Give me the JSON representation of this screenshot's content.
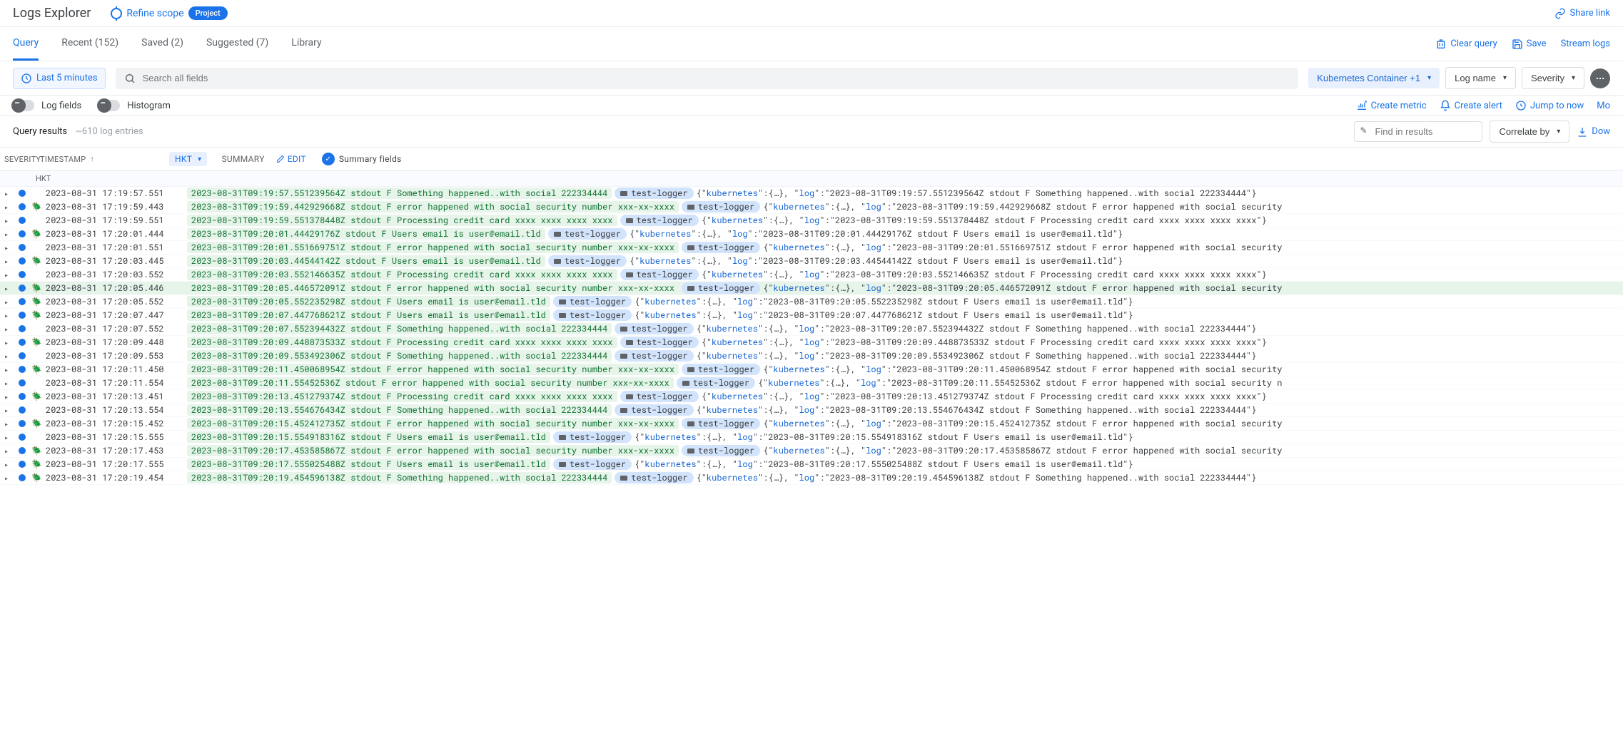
{
  "header": {
    "title": "Logs Explorer",
    "refine": "Refine scope",
    "project_badge": "Project",
    "share": "Share link"
  },
  "tabs": {
    "items": [
      "Query",
      "Recent (152)",
      "Saved (2)",
      "Suggested (7)",
      "Library"
    ],
    "active_index": 0,
    "actions": {
      "clear": "Clear query",
      "save": "Save",
      "stream": "Stream logs"
    }
  },
  "query_bar": {
    "time_range": "Last 5 minutes",
    "search_placeholder": "Search all fields",
    "filters": {
      "resource": "Kubernetes Container +1",
      "log_name": "Log name",
      "severity": "Severity"
    }
  },
  "view_toggles": {
    "log_fields": "Log fields",
    "histogram": "Histogram",
    "actions": {
      "create_metric": "Create metric",
      "create_alert": "Create alert",
      "jump_now": "Jump to now",
      "more": "Mo"
    }
  },
  "results": {
    "label": "Query results",
    "count": "~610 log entries",
    "find_placeholder": "Find in results",
    "correlate": "Correlate by",
    "download": "Dow"
  },
  "columns": {
    "severity": "SEVERITY",
    "timestamp": "TIMESTAMP",
    "tz": "HKT",
    "summary": "SUMMARY",
    "edit": "EDIT",
    "summary_fields": "Summary fields",
    "tz_sub": "HKT"
  },
  "logger_name": "test-logger",
  "logs": [
    {
      "bug": false,
      "ts": "2023-08-31 17:19:57.551",
      "msg": "2023-08-31T09:19:57.551239564Z stdout F Something happened..with social 222334444",
      "tail": "{\"kubernetes\":{…}, \"log\":\"2023-08-31T09:19:57.551239564Z stdout F Something happened..with social 222334444\"}"
    },
    {
      "bug": true,
      "ts": "2023-08-31 17:19:59.443",
      "msg": "2023-08-31T09:19:59.442929668Z stdout F error happened with social security number xxx-xx-xxxx",
      "tail": "{\"kubernetes\":{…}, \"log\":\"2023-08-31T09:19:59.442929668Z stdout F error happened with social security"
    },
    {
      "bug": false,
      "ts": "2023-08-31 17:19:59.551",
      "msg": "2023-08-31T09:19:59.551378448Z stdout F Processing credit card xxxx xxxx xxxx xxxx",
      "tail": "{\"kubernetes\":{…}, \"log\":\"2023-08-31T09:19:59.551378448Z stdout F Processing credit card xxxx xxxx xxxx xxxx\"}"
    },
    {
      "bug": true,
      "ts": "2023-08-31 17:20:01.444",
      "msg": "2023-08-31T09:20:01.44429176Z stdout F Users email is user@email.tld",
      "tail": "{\"kubernetes\":{…}, \"log\":\"2023-08-31T09:20:01.44429176Z stdout F Users email is user@email.tld\"}"
    },
    {
      "bug": false,
      "ts": "2023-08-31 17:20:01.551",
      "msg": "2023-08-31T09:20:01.551669751Z stdout F error happened with social security number xxx-xx-xxxx",
      "tail": "{\"kubernetes\":{…}, \"log\":\"2023-08-31T09:20:01.551669751Z stdout F error happened with social security"
    },
    {
      "bug": true,
      "ts": "2023-08-31 17:20:03.445",
      "msg": "2023-08-31T09:20:03.44544142Z stdout F Users email is user@email.tld",
      "tail": "{\"kubernetes\":{…}, \"log\":\"2023-08-31T09:20:03.44544142Z stdout F Users email is user@email.tld\"}"
    },
    {
      "bug": false,
      "ts": "2023-08-31 17:20:03.552",
      "msg": "2023-08-31T09:20:03.552146635Z stdout F Processing credit card xxxx xxxx xxxx xxxx",
      "tail": "{\"kubernetes\":{…}, \"log\":\"2023-08-31T09:20:03.552146635Z stdout F Processing credit card xxxx xxxx xxxx xxxx\"}"
    },
    {
      "bug": true,
      "sel": true,
      "ts": "2023-08-31 17:20:05.446",
      "msg": "2023-08-31T09:20:05.446572091Z stdout F error happened with social security number xxx-xx-xxxx",
      "tail": "{\"kubernetes\":{…}, \"log\":\"2023-08-31T09:20:05.446572091Z stdout F error happened with social security"
    },
    {
      "bug": true,
      "ts": "2023-08-31 17:20:05.552",
      "msg": "2023-08-31T09:20:05.552235298Z stdout F Users email is user@email.tld",
      "tail": "{\"kubernetes\":{…}, \"log\":\"2023-08-31T09:20:05.552235298Z stdout F Users email is user@email.tld\"}"
    },
    {
      "bug": true,
      "ts": "2023-08-31 17:20:07.447",
      "msg": "2023-08-31T09:20:07.447768621Z stdout F Users email is user@email.tld",
      "tail": "{\"kubernetes\":{…}, \"log\":\"2023-08-31T09:20:07.447768621Z stdout F Users email is user@email.tld\"}"
    },
    {
      "bug": false,
      "ts": "2023-08-31 17:20:07.552",
      "msg": "2023-08-31T09:20:07.552394432Z stdout F Something happened..with social 222334444",
      "tail": "{\"kubernetes\":{…}, \"log\":\"2023-08-31T09:20:07.552394432Z stdout F Something happened..with social 222334444\"}"
    },
    {
      "bug": true,
      "ts": "2023-08-31 17:20:09.448",
      "msg": "2023-08-31T09:20:09.448873533Z stdout F Processing credit card xxxx xxxx xxxx xxxx",
      "tail": "{\"kubernetes\":{…}, \"log\":\"2023-08-31T09:20:09.448873533Z stdout F Processing credit card xxxx xxxx xxxx xxxx\"}"
    },
    {
      "bug": false,
      "ts": "2023-08-31 17:20:09.553",
      "msg": "2023-08-31T09:20:09.553492306Z stdout F Something happened..with social 222334444",
      "tail": "{\"kubernetes\":{…}, \"log\":\"2023-08-31T09:20:09.553492306Z stdout F Something happened..with social 222334444\"}"
    },
    {
      "bug": true,
      "ts": "2023-08-31 17:20:11.450",
      "msg": "2023-08-31T09:20:11.450068954Z stdout F error happened with social security number xxx-xx-xxxx",
      "tail": "{\"kubernetes\":{…}, \"log\":\"2023-08-31T09:20:11.450068954Z stdout F error happened with social security"
    },
    {
      "bug": false,
      "ts": "2023-08-31 17:20:11.554",
      "msg": "2023-08-31T09:20:11.55452536Z stdout F error happened with social security number xxx-xx-xxxx",
      "tail": "{\"kubernetes\":{…}, \"log\":\"2023-08-31T09:20:11.55452536Z stdout F error happened with social security n"
    },
    {
      "bug": true,
      "ts": "2023-08-31 17:20:13.451",
      "msg": "2023-08-31T09:20:13.451279374Z stdout F Processing credit card xxxx xxxx xxxx xxxx",
      "tail": "{\"kubernetes\":{…}, \"log\":\"2023-08-31T09:20:13.451279374Z stdout F Processing credit card xxxx xxxx xxxx xxxx\"}"
    },
    {
      "bug": false,
      "ts": "2023-08-31 17:20:13.554",
      "msg": "2023-08-31T09:20:13.554676434Z stdout F Something happened..with social 222334444",
      "tail": "{\"kubernetes\":{…}, \"log\":\"2023-08-31T09:20:13.554676434Z stdout F Something happened..with social 222334444\"}"
    },
    {
      "bug": true,
      "ts": "2023-08-31 17:20:15.452",
      "msg": "2023-08-31T09:20:15.452412735Z stdout F error happened with social security number xxx-xx-xxxx",
      "tail": "{\"kubernetes\":{…}, \"log\":\"2023-08-31T09:20:15.452412735Z stdout F error happened with social security"
    },
    {
      "bug": false,
      "ts": "2023-08-31 17:20:15.555",
      "msg": "2023-08-31T09:20:15.554918316Z stdout F Users email is user@email.tld",
      "tail": "{\"kubernetes\":{…}, \"log\":\"2023-08-31T09:20:15.554918316Z stdout F Users email is user@email.tld\"}"
    },
    {
      "bug": true,
      "ts": "2023-08-31 17:20:17.453",
      "msg": "2023-08-31T09:20:17.453585867Z stdout F error happened with social security number xxx-xx-xxxx",
      "tail": "{\"kubernetes\":{…}, \"log\":\"2023-08-31T09:20:17.453585867Z stdout F error happened with social security"
    },
    {
      "bug": true,
      "ts": "2023-08-31 17:20:17.555",
      "msg": "2023-08-31T09:20:17.555025488Z stdout F Users email is user@email.tld",
      "tail": "{\"kubernetes\":{…}, \"log\":\"2023-08-31T09:20:17.555025488Z stdout F Users email is user@email.tld\"}"
    },
    {
      "bug": true,
      "ts": "2023-08-31 17:20:19.454",
      "msg": "2023-08-31T09:20:19.454596138Z stdout F Something happened..with social 222334444",
      "tail": "{\"kubernetes\":{…}, \"log\":\"2023-08-31T09:20:19.454596138Z stdout F Something happened..with social 222334444\"}"
    }
  ]
}
